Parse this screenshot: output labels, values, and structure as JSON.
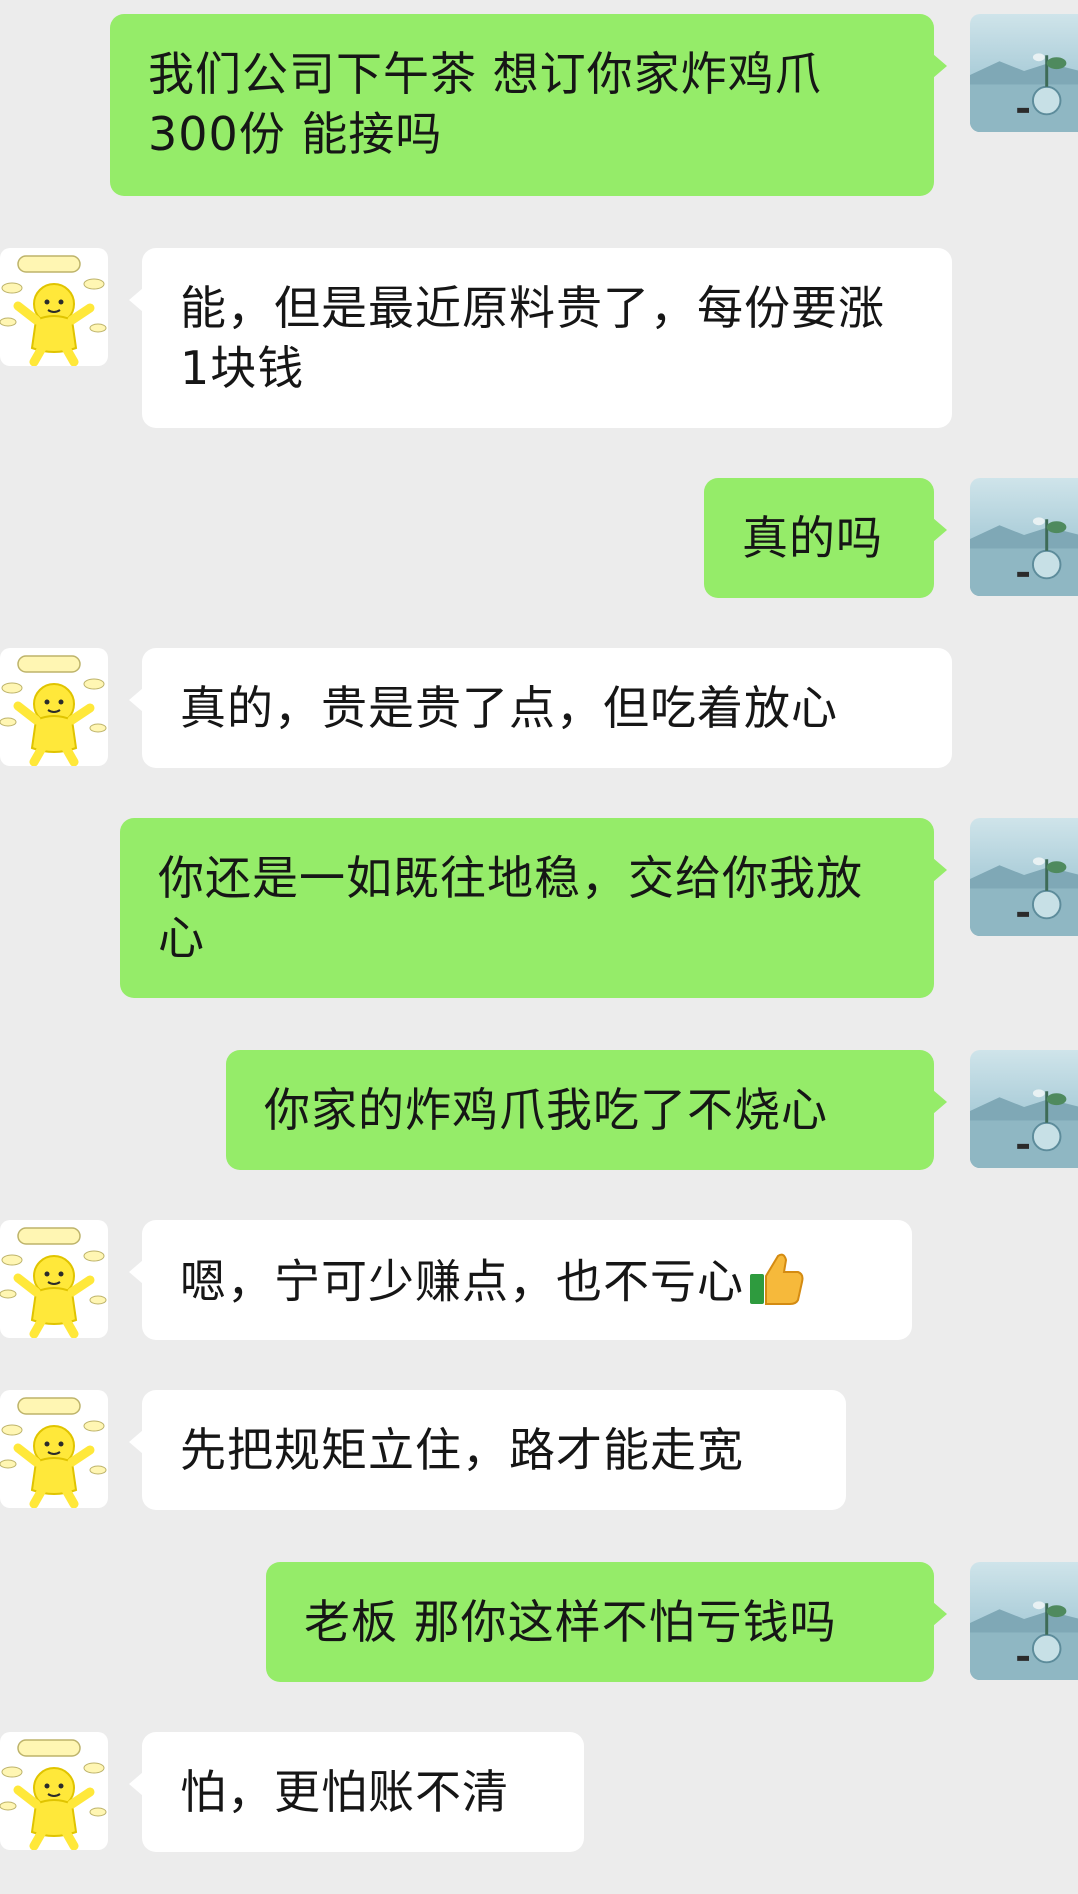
{
  "conversation": {
    "messages": [
      {
        "side": "sent",
        "text": "我们公司下午茶 想订你家炸鸡爪300份 能接吗"
      },
      {
        "side": "received",
        "text": "能，但是最近原料贵了，每份要涨1块钱"
      },
      {
        "side": "sent",
        "text": "真的吗"
      },
      {
        "side": "received",
        "text": "真的，贵是贵了点，但吃着放心"
      },
      {
        "side": "sent",
        "text": "你还是一如既往地稳，交给你我放心"
      },
      {
        "side": "sent",
        "text": "你家的炸鸡爪我吃了不烧心"
      },
      {
        "side": "received",
        "text": "嗯，宁可少赚点，也不亏心",
        "emoji": "thumbs-up-icon"
      },
      {
        "side": "received",
        "text": "先把规矩立住，路才能走宽"
      },
      {
        "side": "sent",
        "text": "老板 那你这样不怕亏钱吗"
      },
      {
        "side": "received",
        "text": "怕，更怕账不清"
      }
    ]
  },
  "avatars": {
    "me": {
      "icon": "lake-vase-avatar-icon"
    },
    "them": {
      "icon": "yellow-cartoon-avatar-icon"
    }
  },
  "colors": {
    "background": "#ececec",
    "sent_bubble": "#95ec69",
    "received_bubble": "#ffffff",
    "text": "#161616"
  }
}
